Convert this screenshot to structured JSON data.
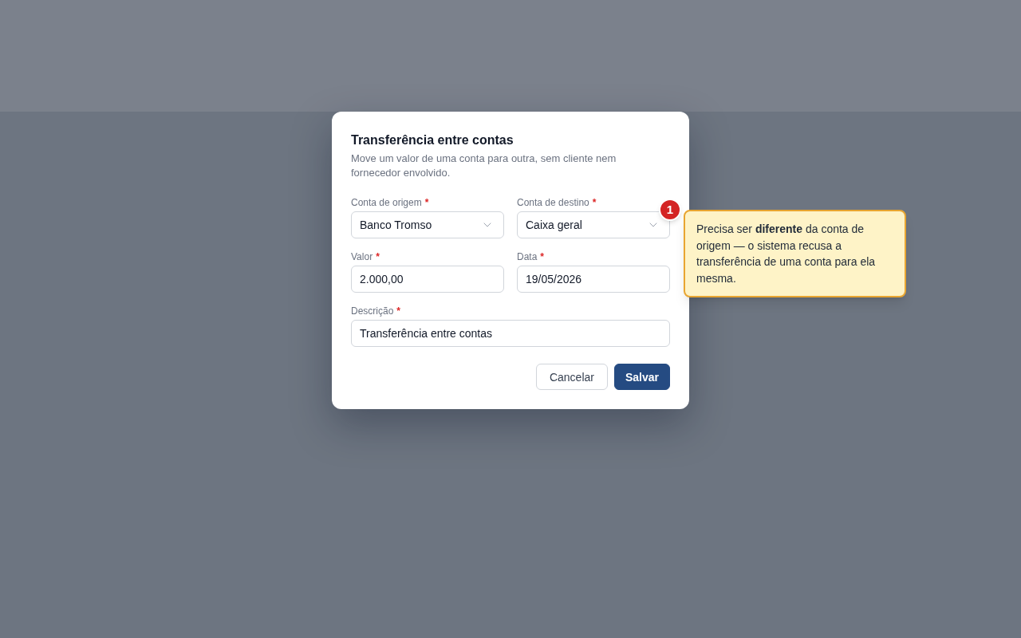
{
  "dialog": {
    "title": "Transferência entre contas",
    "description": "Move um valor de uma conta para outra, sem cliente nem fornecedor envolvido.",
    "field_rows": [
      {
        "fields": [
          {
            "label": "Conta de origem",
            "required_mark": "*",
            "kind": "select",
            "value": "Banco Tromso"
          },
          {
            "label": "Conta de destino",
            "required_mark": "*",
            "kind": "select",
            "value": "Caixa geral"
          }
        ]
      },
      {
        "fields": [
          {
            "label": "Valor",
            "required_mark": "*",
            "kind": "text",
            "value": "2.000,00"
          },
          {
            "label": "Data",
            "required_mark": "*",
            "kind": "text",
            "value": "19/05/2026"
          }
        ]
      },
      {
        "fields": [
          {
            "label": "Descrição",
            "required_mark": "*",
            "kind": "text",
            "value": "Transferência entre contas"
          }
        ]
      }
    ],
    "buttons": [
      {
        "label": "Cancelar",
        "kind": "secondary"
      },
      {
        "label": "Salvar",
        "kind": "primary"
      }
    ]
  },
  "callout": {
    "number": "1",
    "text": "Precisa ser **diferente** da conta de origem — o sistema recusa a transferência de uma conta para ela mesma."
  }
}
